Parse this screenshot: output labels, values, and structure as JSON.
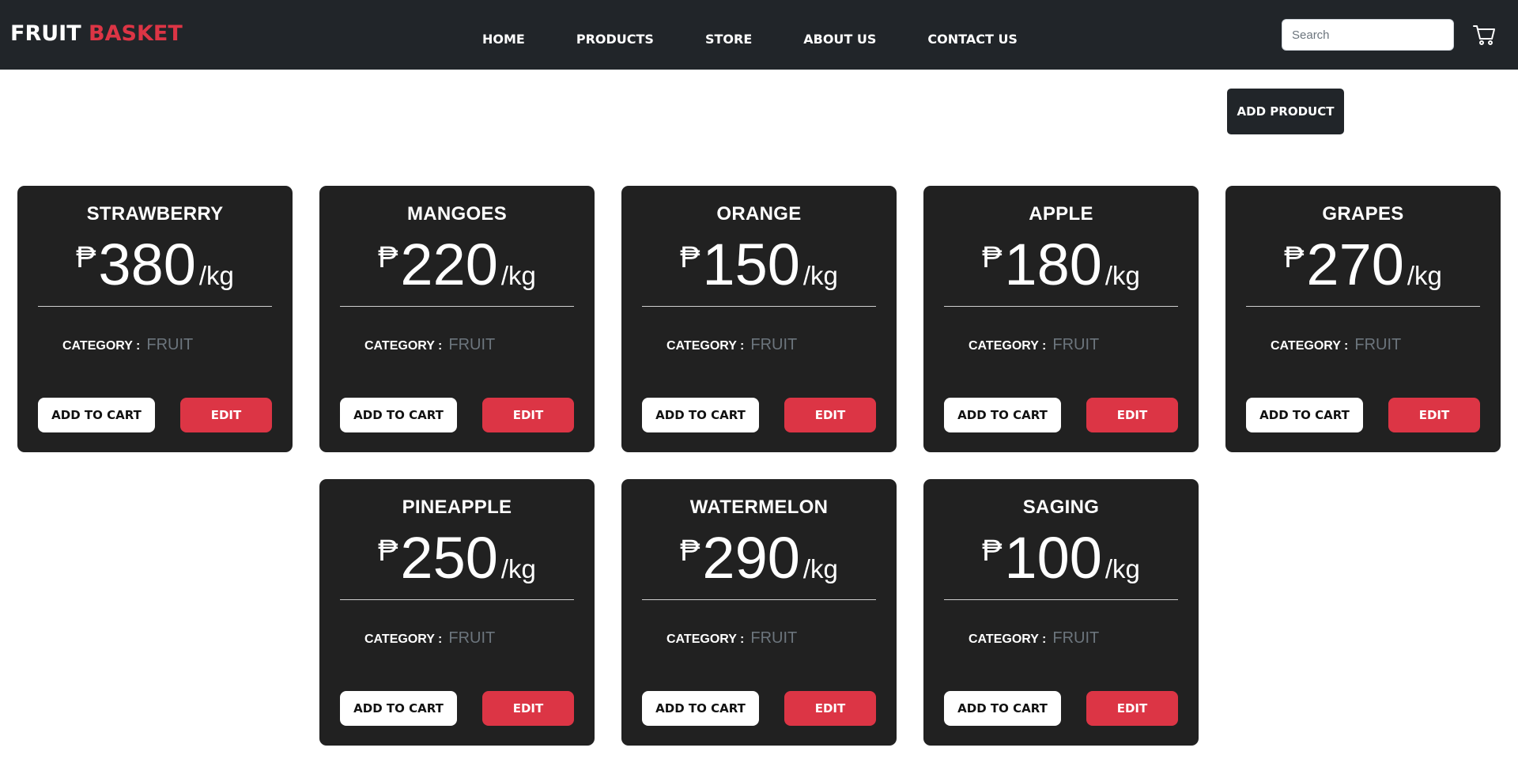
{
  "brand": {
    "part1": "FRUIT",
    "part2": "BASKET",
    "accent_color": "#dc3545"
  },
  "nav": {
    "items": [
      {
        "label": "HOME"
      },
      {
        "label": "PRODUCTS"
      },
      {
        "label": "STORE"
      },
      {
        "label": "ABOUT US"
      },
      {
        "label": "CONTACT US"
      }
    ]
  },
  "search": {
    "placeholder": "Search",
    "value": ""
  },
  "cart": {
    "icon": "shopping-cart-icon"
  },
  "add_product_label": "ADD PRODUCT",
  "currency_symbol": "₱",
  "unit": "/kg",
  "category_label": "CATEGORY :",
  "add_to_cart_label": "ADD TO CART",
  "edit_label": "EDIT",
  "colors": {
    "navbar": "#212529",
    "card": "#212121",
    "edit_button": "#dc3545",
    "category_value": "#6c757d"
  },
  "products": [
    {
      "name": "STRAWBERRY",
      "price": "380",
      "category": "FRUIT"
    },
    {
      "name": "MANGOES",
      "price": "220",
      "category": "FRUIT"
    },
    {
      "name": "ORANGE",
      "price": "150",
      "category": "FRUIT"
    },
    {
      "name": "APPLE",
      "price": "180",
      "category": "FRUIT"
    },
    {
      "name": "GRAPES",
      "price": "270",
      "category": "FRUIT"
    },
    {
      "name": "PINEAPPLE",
      "price": "250",
      "category": "FRUIT"
    },
    {
      "name": "WATERMELON",
      "price": "290",
      "category": "FRUIT"
    },
    {
      "name": "SAGING",
      "price": "100",
      "category": "FRUIT"
    }
  ]
}
